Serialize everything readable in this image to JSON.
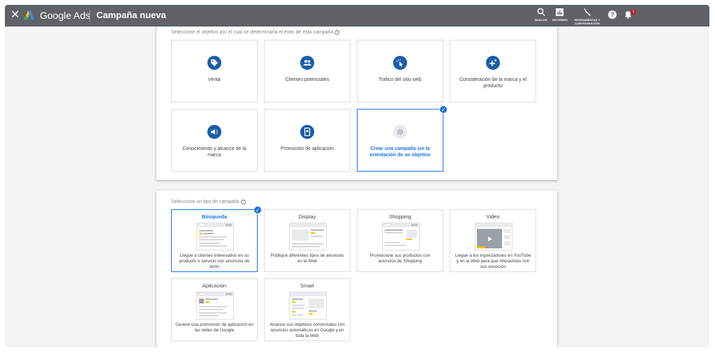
{
  "header": {
    "close_icon": "close-icon",
    "brand": "Google Ads",
    "title": "Campaña nueva",
    "tools": [
      {
        "label": "BUSCAR",
        "icon": "search-icon"
      },
      {
        "label": "INFORMES",
        "icon": "reports-icon"
      },
      {
        "label": "HERRAMIENTAS Y CONFIGURACIÓN",
        "icon": "wrench-icon"
      }
    ],
    "help_icon": "help-icon",
    "help_glyph": "?",
    "notifications_icon": "bell-icon",
    "notifications_count": "1"
  },
  "objectives": {
    "label": "Seleccione el objetivo por el cual se determinaría el éxito de esta campaña",
    "items": [
      {
        "label": "Venta",
        "icon": "tag-icon"
      },
      {
        "label": "Clientes potenciales",
        "icon": "people-icon"
      },
      {
        "label": "Tráfico del sitio web",
        "icon": "cursor-click-icon"
      },
      {
        "label": "Consideración de la marca y el producto",
        "icon": "sparkle-icon"
      },
      {
        "label": "Conocimiento y alcance de la marca",
        "icon": "megaphone-icon"
      },
      {
        "label": "Promoción de aplicación",
        "icon": "phone-icon"
      },
      {
        "label": "Crear una campaña sin la orientación de un objetivo",
        "icon": "gear-icon",
        "selected": true
      }
    ]
  },
  "campaign_types": {
    "label": "Seleccione un tipo de campaña",
    "items": [
      {
        "title": "Búsqueda",
        "desc": "Llegue a clientes interesados en su producto o servicio con anuncios de texto",
        "selected": true
      },
      {
        "title": "Display",
        "desc": "Publique diferentes tipos de anuncios en la Web"
      },
      {
        "title": "Shopping",
        "desc": "Promocione sus productos con anuncios de Shopping"
      },
      {
        "title": "Video",
        "desc": "Llegue a los espectadores en YouTube y en la Web para que interactúen con sus anuncios"
      },
      {
        "title": "Aplicación",
        "desc": "Genere una promoción de aplicación en las redes de Google"
      },
      {
        "title": "Smart",
        "desc": "Alcance sus objetivos comerciales con anuncios automáticos en Google y en toda la Web"
      }
    ]
  },
  "colors": {
    "header_bg": "#5f6368",
    "accent": "#1a73e8",
    "icon_blue": "#1a5ea8",
    "badge_red": "#c5221f"
  }
}
